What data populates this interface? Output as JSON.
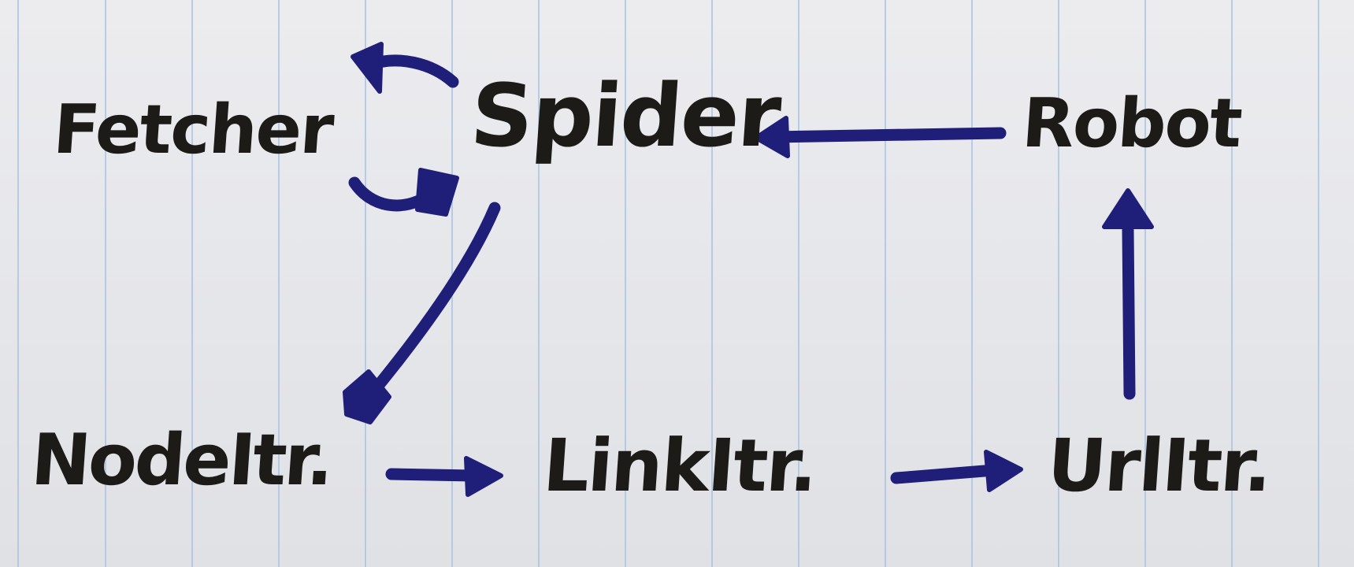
{
  "nodes": {
    "fetcher": "Fetcher",
    "spider": "Spider",
    "robot": "Robot",
    "node_itr": "NodeItr.",
    "link_itr": "LinkItr.",
    "url_itr": "UrlItr."
  },
  "edges": [
    {
      "from": "Spider",
      "to": "Fetcher"
    },
    {
      "from": "Fetcher",
      "to": "Spider"
    },
    {
      "from": "Robot",
      "to": "Spider"
    },
    {
      "from": "Spider",
      "to": "NodeItr."
    },
    {
      "from": "NodeItr.",
      "to": "LinkItr."
    },
    {
      "from": "LinkItr.",
      "to": "UrlItr."
    },
    {
      "from": "UrlItr.",
      "to": "Robot"
    }
  ],
  "colors": {
    "ink_text": "#1c1b18",
    "ink_arrows": "#1f1f7a",
    "paper": "#e6e7ea",
    "rule_lines": "#a9c3e4"
  }
}
